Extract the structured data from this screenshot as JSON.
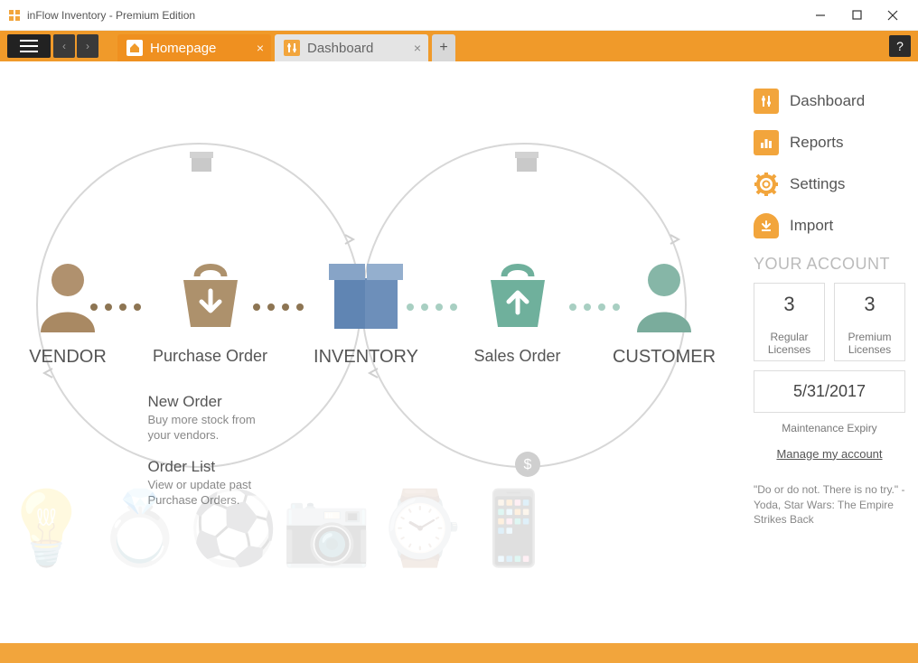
{
  "window": {
    "title": "inFlow Inventory - Premium Edition"
  },
  "toolbar": {
    "tabs": [
      {
        "label": "Homepage",
        "active": true
      },
      {
        "label": "Dashboard",
        "active": false
      }
    ]
  },
  "diagram": {
    "vendor_label": "VENDOR",
    "purchase_title": "Purchase Order",
    "inventory_label": "INVENTORY",
    "sales_title": "Sales Order",
    "customer_label": "CUSTOMER",
    "new_order_title": "New Order",
    "new_order_desc": "Buy more stock from your vendors.",
    "order_list_title": "Order List",
    "order_list_desc": "View or update past Purchase Orders."
  },
  "sidebar": {
    "dashboard": "Dashboard",
    "reports": "Reports",
    "settings": "Settings",
    "import": "Import",
    "account_header": "YOUR ACCOUNT",
    "regular_count": "3",
    "regular_label": "Regular\nLicenses",
    "premium_count": "3",
    "premium_label": "Premium\nLicenses",
    "expiry_date": "5/31/2017",
    "expiry_label": "Maintenance Expiry",
    "manage_link": "Manage my account",
    "quote": "\"Do or do not. There is no try.\" -Yoda, Star Wars: The Empire Strikes Back"
  }
}
